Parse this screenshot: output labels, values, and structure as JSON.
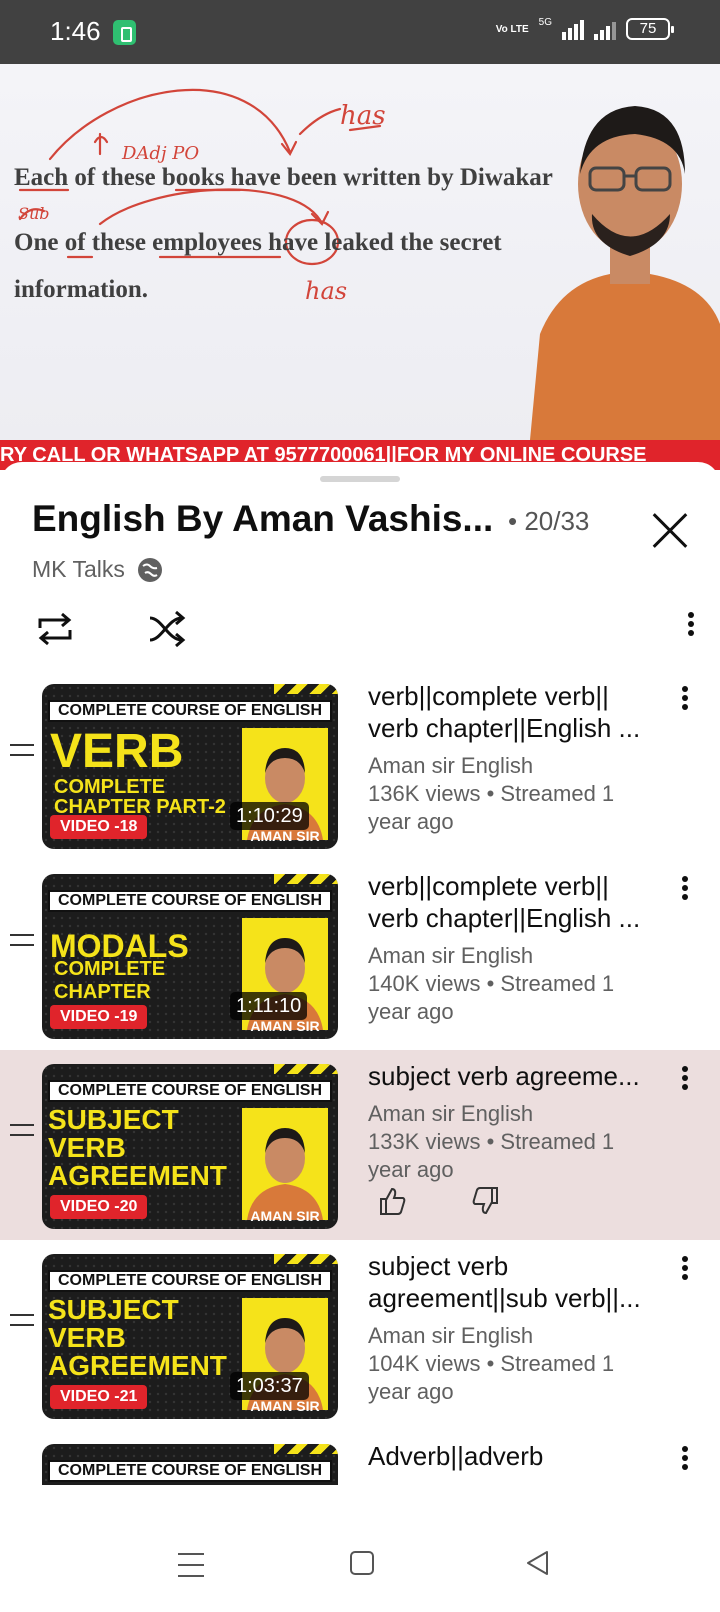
{
  "status_bar": {
    "time": "1:46",
    "network_volte": "Vo LTE",
    "network_5g": "5G",
    "battery": "75"
  },
  "video": {
    "board_lines": [
      "Each of these books have been written by Diwakar",
      "One of these employees have leaked the secret",
      "information."
    ],
    "ticker": "RY CALL OR WHATSAPP AT 9577700061||FOR MY ONLINE COURSE"
  },
  "playlist": {
    "title": "English By Aman Vashis...",
    "position": "• 20/33",
    "channel": "MK Talks"
  },
  "items": [
    {
      "thumb_header": "COMPLETE COURSE OF ENGLISH",
      "thumb_big": "VERB",
      "thumb_sub1": "COMPLETE",
      "thumb_sub2": "CHAPTER PART-2",
      "thumb_badge": "VIDEO -18",
      "thumb_name": "AMAN SIR",
      "duration": "1:10:29",
      "title": "verb||complete verb|| verb chapter||English ...",
      "channel": "Aman sir English",
      "stats": "136K views • Streamed 1 year ago"
    },
    {
      "thumb_header": "COMPLETE COURSE OF ENGLISH",
      "thumb_big": "MODALS",
      "thumb_sub1": "COMPLETE",
      "thumb_sub2": "CHAPTER",
      "thumb_badge": "VIDEO -19",
      "thumb_name": "AMAN SIR",
      "duration": "1:11:10",
      "title": "verb||complete verb|| verb chapter||English ...",
      "channel": "Aman sir English",
      "stats": "140K views • Streamed 1 year ago"
    },
    {
      "thumb_header": "COMPLETE COURSE OF ENGLISH",
      "thumb_lines": [
        "SUBJECT",
        "VERB",
        "AGREEMENT"
      ],
      "thumb_badge": "VIDEO -20",
      "thumb_name": "AMAN SIR",
      "title": "subject verb agreeme...",
      "channel": "Aman sir English",
      "stats": "133K views • Streamed 1 year ago",
      "active": true
    },
    {
      "thumb_header": "COMPLETE COURSE OF ENGLISH",
      "thumb_lines": [
        "SUBJECT",
        "VERB",
        "AGREEMENT"
      ],
      "thumb_badge": "VIDEO -21",
      "thumb_name": "AMAN SIR",
      "duration": "1:03:37",
      "title": "subject verb agreement||sub verb||...",
      "channel": "Aman sir English",
      "stats": "104K views • Streamed 1 year ago"
    },
    {
      "thumb_header": "COMPLETE COURSE OF ENGLISH",
      "title": "Adverb||adverb"
    }
  ],
  "icons": {
    "repeat": "repeat-icon",
    "shuffle": "shuffle-icon",
    "more": "more-vert-icon",
    "close": "close-icon",
    "globe": "globe-icon",
    "drag": "drag-handle-icon",
    "like": "thumbs-up-icon",
    "dislike": "thumbs-down-icon"
  },
  "colors": {
    "accent_red": "#e0242b",
    "thumb_yellow": "#f5e31a",
    "active_row": "#ecdede"
  }
}
